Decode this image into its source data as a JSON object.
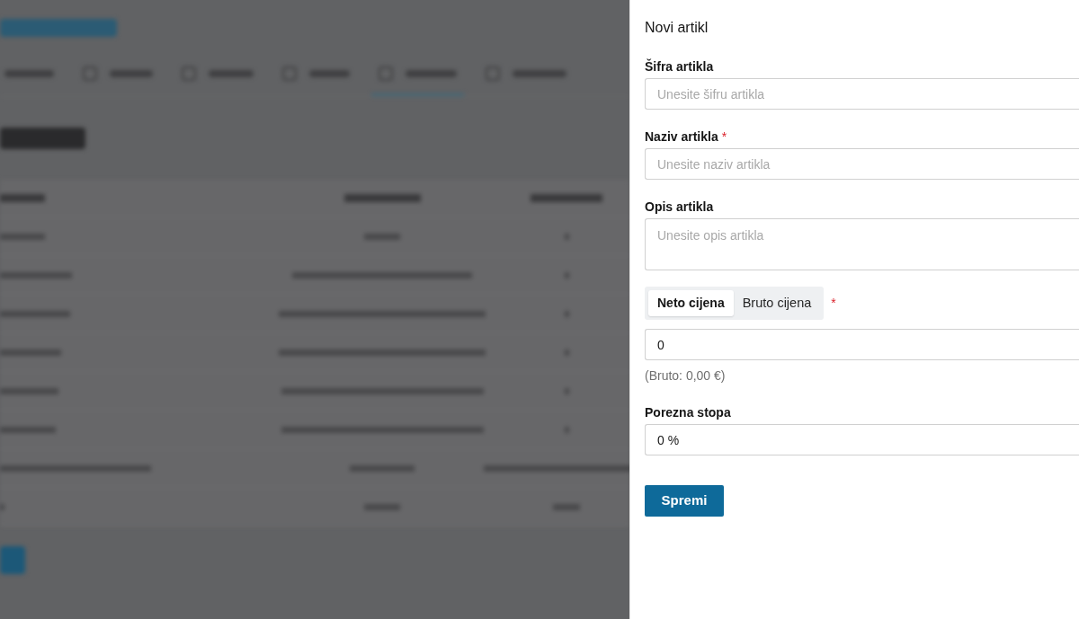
{
  "drawer": {
    "title": "Novi artikl",
    "fields": [
      {
        "kind": "input",
        "label": "Šifra artikla",
        "placeholder": "Unesite šifru artikla"
      },
      {
        "kind": "input",
        "label": "Naziv artikla",
        "required_mark": "*",
        "placeholder": "Unesite naziv artikla"
      },
      {
        "kind": "textarea",
        "label": "Opis artikla",
        "placeholder": "Unesite opis artikla"
      },
      {
        "kind": "price",
        "tabs": [
          {
            "label": "Neto cijena",
            "selected": true
          },
          {
            "label": "Bruto cijena",
            "selected": false
          }
        ],
        "required_mark": "*",
        "value": "0",
        "hint": "(Bruto: 0,00 €)"
      },
      {
        "kind": "input",
        "label": "Porezna stopa",
        "value": "0 %"
      }
    ],
    "save_button": "Spremi"
  }
}
